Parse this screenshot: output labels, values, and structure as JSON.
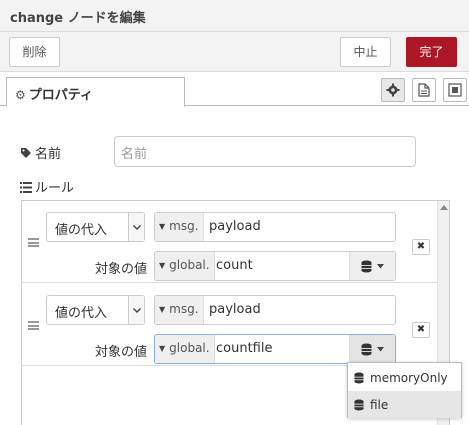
{
  "tray": {
    "title": "change ノードを編集"
  },
  "toolbar": {
    "delete_label": "削除",
    "cancel_label": "中止",
    "done_label": "完了"
  },
  "tabs": [
    {
      "label": "プロパティ",
      "icon": "gear-icon"
    }
  ],
  "tab_buttons": [
    "gear-icon",
    "document-icon",
    "layout-icon"
  ],
  "form": {
    "name_label": "名前",
    "name_placeholder": "名前",
    "name_value": "",
    "rules_label": "ルール"
  },
  "rules": [
    {
      "action": "値の代入",
      "property_type": "msg.",
      "property_value": "payload",
      "to_label": "対象の値",
      "to_type": "global.",
      "to_value": "count"
    },
    {
      "action": "値の代入",
      "property_type": "msg.",
      "property_value": "payload",
      "to_label": "対象の値",
      "to_type": "global.",
      "to_value": "countfile"
    }
  ],
  "store_dropdown": {
    "options": [
      "memoryOnly",
      "file"
    ],
    "selected": "file"
  },
  "colors": {
    "primary_button": "#ad1625",
    "focus_border": "#85b2e0"
  }
}
